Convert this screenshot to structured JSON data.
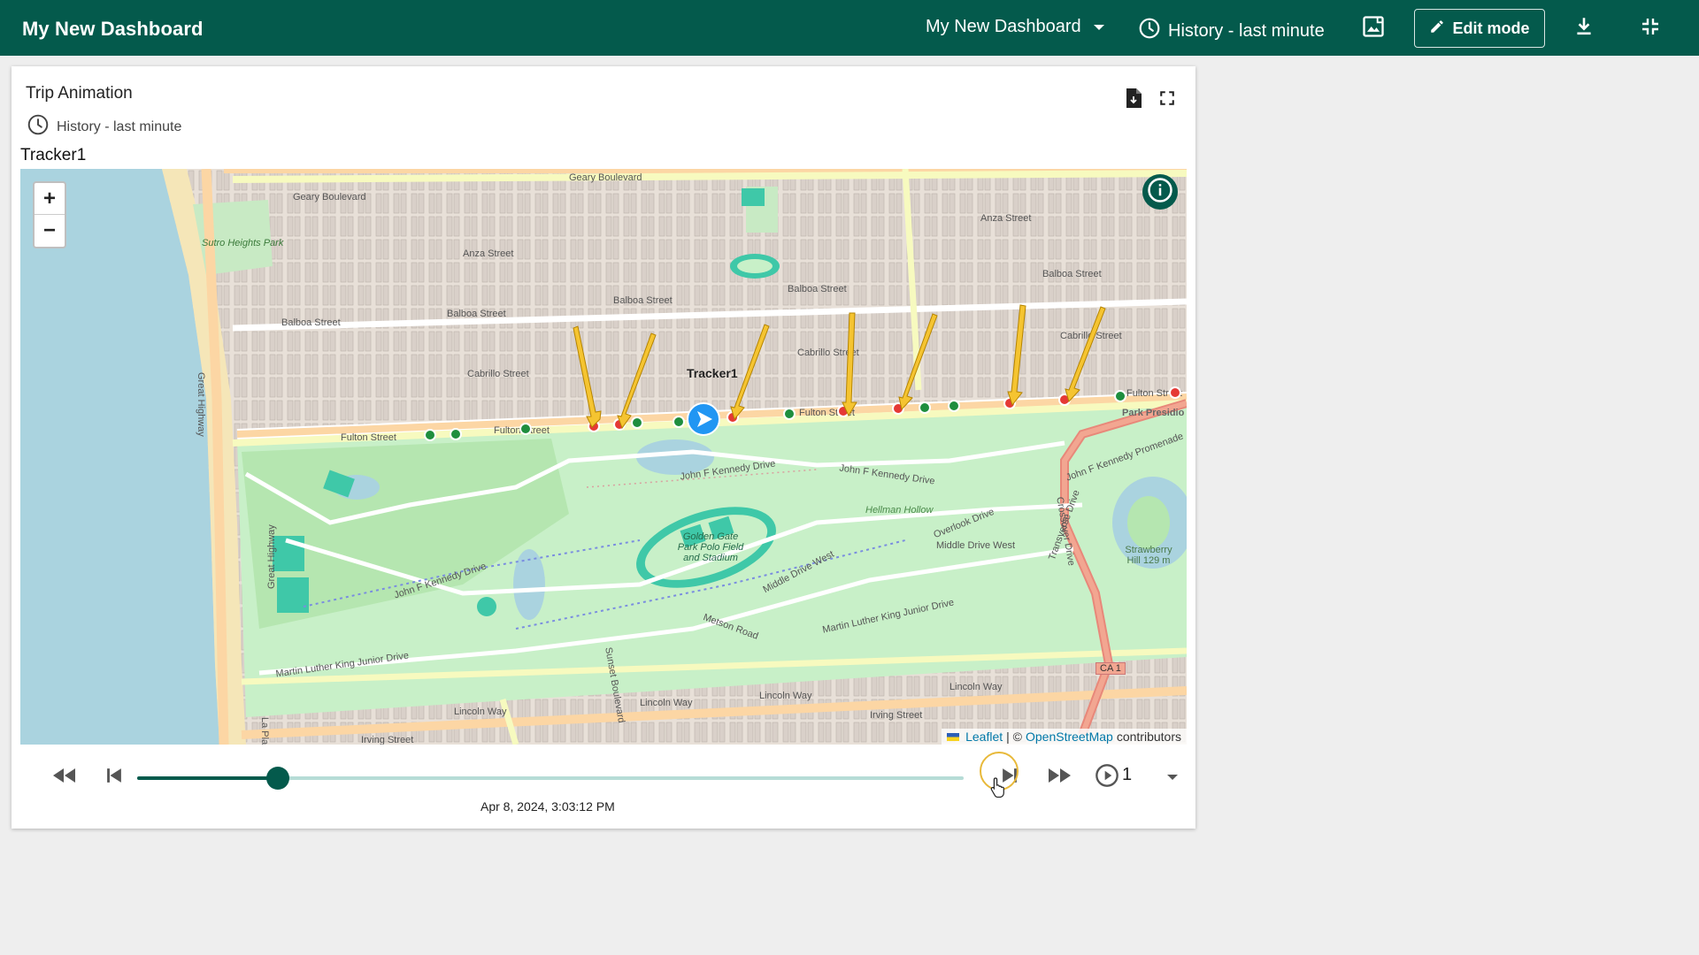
{
  "topbar": {
    "title": "My New Dashboard",
    "dashboard_select": "My New Dashboard",
    "history": "History - last minute",
    "edit_label": "Edit mode"
  },
  "card": {
    "title": "Trip Animation",
    "history": "History - last minute",
    "tracker_label": "Tracker1"
  },
  "map": {
    "tracker_name": "Tracker1",
    "attribution": {
      "leaflet": "Leaflet",
      "sep": "| ©",
      "osm": "OpenStreetMap",
      "contrib": "contributors"
    },
    "zoom_in": "+",
    "zoom_out": "−",
    "labels": [
      "Geary Boulevard",
      "Geary Boulevard",
      "Sutro Heights Park",
      "Balboa Street",
      "Balboa Street",
      "Balboa Street",
      "Balboa Street",
      "Balboa Street",
      "Anza Street",
      "Anza Street",
      "Cabrillo Street",
      "Cabrillo Street",
      "Cabrillo Street",
      "Fulton Street",
      "Fulton Street",
      "Fulton Street",
      "Fulton Street",
      "Park Presidio Bypass Dr",
      "John F Kennedy Drive",
      "John F Kennedy Drive",
      "John F Kennedy Drive",
      "Great Highway",
      "Great Highway",
      "Middle Drive West",
      "Middle Drive West",
      "Overlook Drive",
      "Hellman Hollow",
      "Golden Gate Park Polo Field and Stadium",
      "Martin Luther King Junior Drive",
      "Martin Luther King Junior Drive",
      "Lincoln Way",
      "Lincoln Way",
      "Lincoln Way",
      "Lincoln Way",
      "Irving Street",
      "Irving Street",
      "Crossover Drive",
      "Transverse Drive",
      "Strawberry Hill 129 m",
      "CA 1",
      "Metson Road",
      "Sunset Boulevard",
      "John F Kennedy Promenade",
      "La Playa"
    ]
  },
  "controls": {
    "date": "Apr 8, 2024, 3:03:12 PM",
    "speed": "1",
    "progress": 0.17
  },
  "colors": {
    "primary": "#045a4c",
    "marker_red": "#e53935",
    "marker_green": "#1e8e3e",
    "arrow": "#f5c431",
    "player": "#2196f3"
  }
}
